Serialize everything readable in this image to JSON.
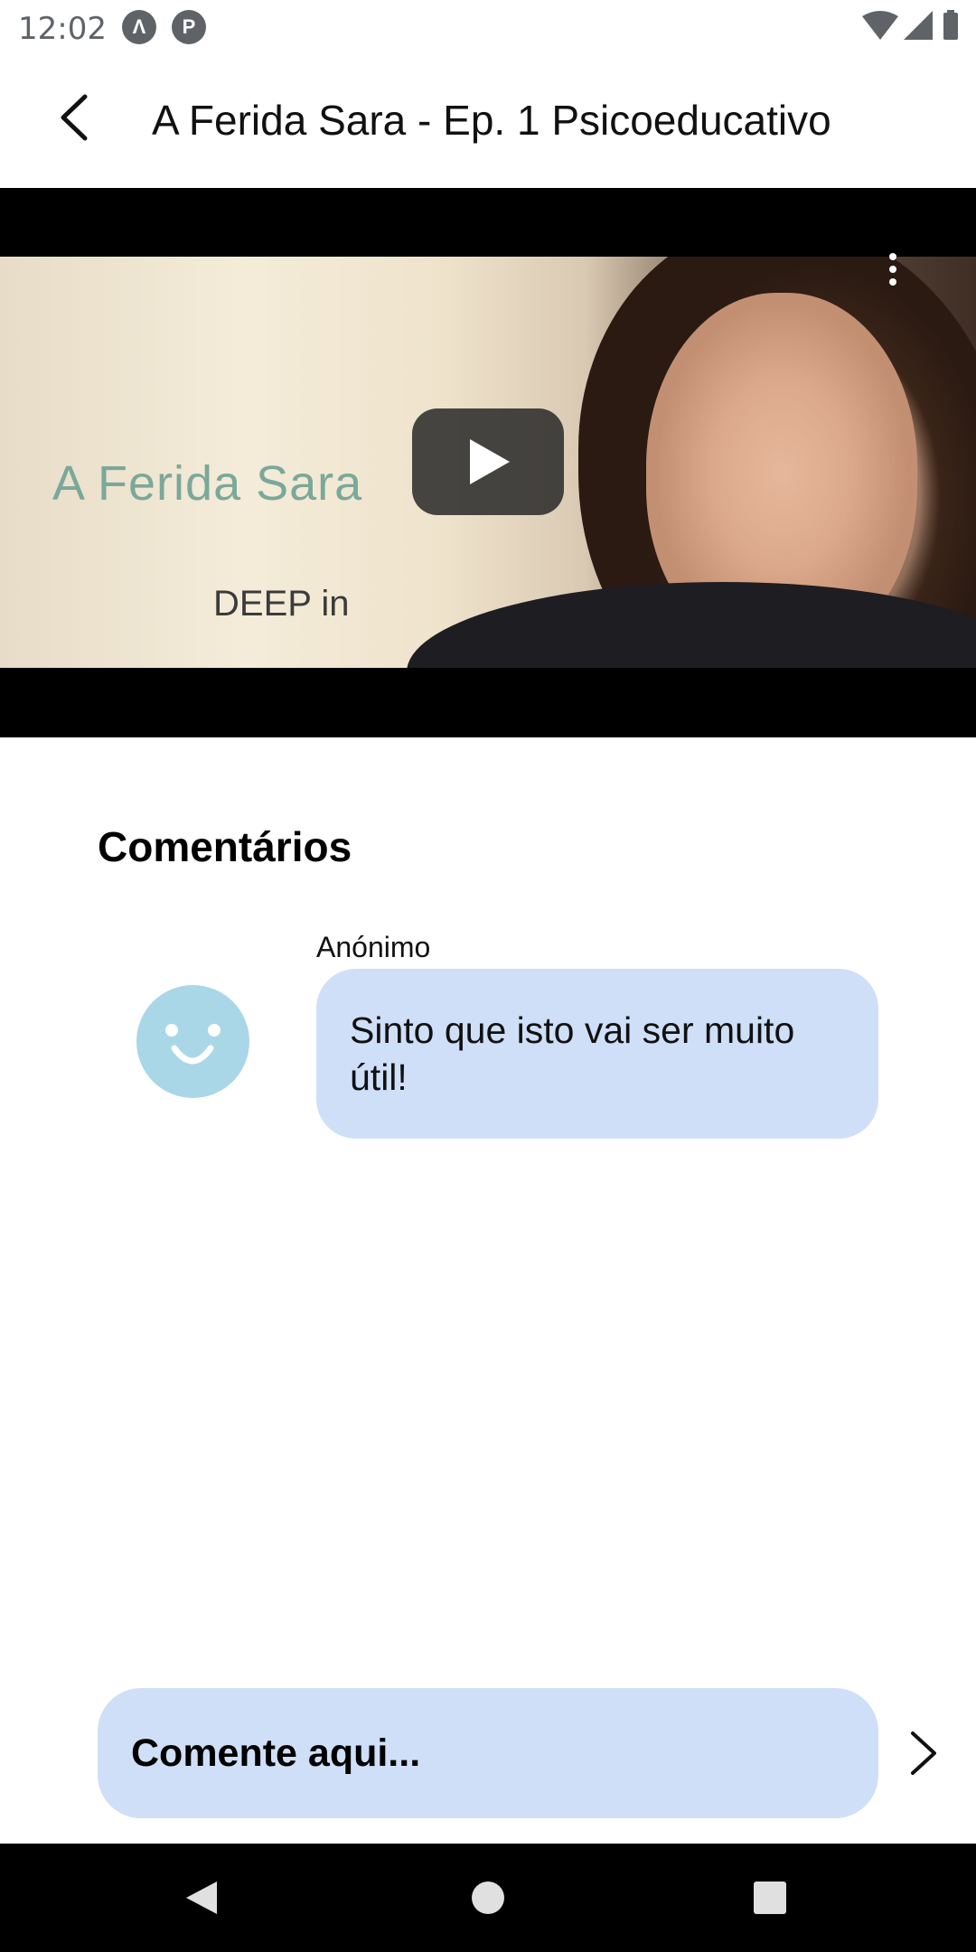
{
  "status_bar": {
    "time": "12:02",
    "app_icons": [
      "Λ",
      "P"
    ],
    "icons": [
      "wifi-icon",
      "signal-icon",
      "battery-icon"
    ]
  },
  "app_bar": {
    "title": "A Ferida Sara - Ep. 1 Psicoeducativo",
    "back_icon": "chevron-left-icon"
  },
  "video": {
    "thumbnail_title": "A Ferida Sara",
    "thumbnail_subtitle": "DEEP in",
    "play_icon": "play-icon",
    "more_icon": "more-vert-icon"
  },
  "comments": {
    "heading": "Comentários",
    "items": [
      {
        "author": "Anónimo",
        "text": "Sinto que isto vai ser muito útil!",
        "avatar_icon": "smiley-icon"
      }
    ]
  },
  "composer": {
    "placeholder": "Comente aqui...",
    "send_icon": "chevron-right-icon"
  },
  "colors": {
    "bubble": "#cfdff7",
    "avatar": "#a9d7e8",
    "nav_bar": "#000000"
  }
}
